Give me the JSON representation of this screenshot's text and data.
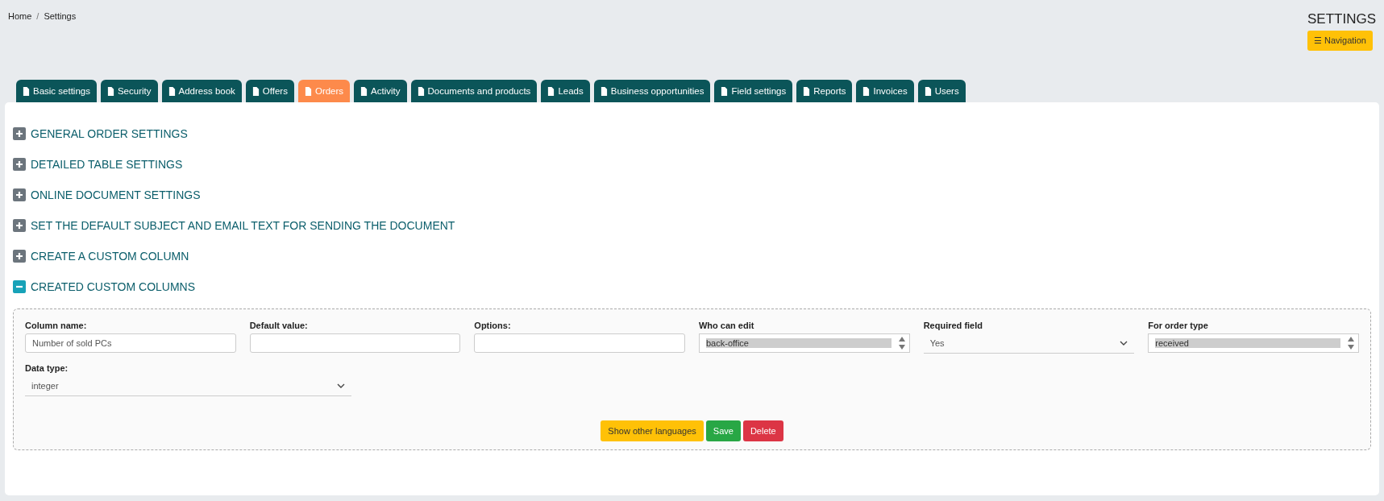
{
  "breadcrumb": [
    "Home",
    "Settings"
  ],
  "breadcrumb_separator": "/",
  "page_title": "SETTINGS",
  "navigation_button": {
    "icon": "☰",
    "label": "Navigation"
  },
  "tabs": [
    {
      "label": "Basic settings",
      "selected": false
    },
    {
      "label": "Security",
      "selected": false
    },
    {
      "label": "Address book",
      "selected": false
    },
    {
      "label": "Offers",
      "selected": false
    },
    {
      "label": "Orders",
      "selected": true
    },
    {
      "label": "Activity",
      "selected": false
    },
    {
      "label": "Documents and products",
      "selected": false
    },
    {
      "label": "Leads",
      "selected": false
    },
    {
      "label": "Business opportunities",
      "selected": false
    },
    {
      "label": "Field settings",
      "selected": false
    },
    {
      "label": "Reports",
      "selected": false
    },
    {
      "label": "Invoices",
      "selected": false
    },
    {
      "label": "Users",
      "selected": false
    }
  ],
  "sections": [
    {
      "title": "GENERAL ORDER SETTINGS",
      "expanded": false
    },
    {
      "title": "DETAILED TABLE SETTINGS",
      "expanded": false
    },
    {
      "title": "ONLINE DOCUMENT SETTINGS",
      "expanded": false
    },
    {
      "title": "SET THE DEFAULT SUBJECT AND EMAIL TEXT FOR SENDING THE DOCUMENT",
      "expanded": false
    },
    {
      "title": "CREATE A CUSTOM COLUMN",
      "expanded": false
    },
    {
      "title": "CREATED CUSTOM COLUMNS",
      "expanded": true
    }
  ],
  "custom_column": {
    "fields": [
      {
        "kind": "text",
        "label": "Column name:",
        "value": "Number of sold PCs"
      },
      {
        "kind": "text",
        "label": "Default value:"
      },
      {
        "kind": "text",
        "label": "Options:"
      },
      {
        "kind": "multiselect",
        "label": "Who can edit",
        "options": [
          {
            "label": "back-office",
            "selected": true
          }
        ]
      },
      {
        "kind": "select",
        "label": "Required field",
        "value": "Yes"
      },
      {
        "kind": "multiselect",
        "label": "For order type",
        "options": [
          {
            "label": "received",
            "selected": true
          }
        ]
      },
      {
        "kind": "select",
        "label": "Data type:",
        "value": "integer"
      }
    ],
    "buttons": [
      {
        "kind": "warning",
        "label": "Show other languages"
      },
      {
        "kind": "success",
        "label": "Save"
      },
      {
        "kind": "danger",
        "label": "Delete"
      }
    ]
  }
}
